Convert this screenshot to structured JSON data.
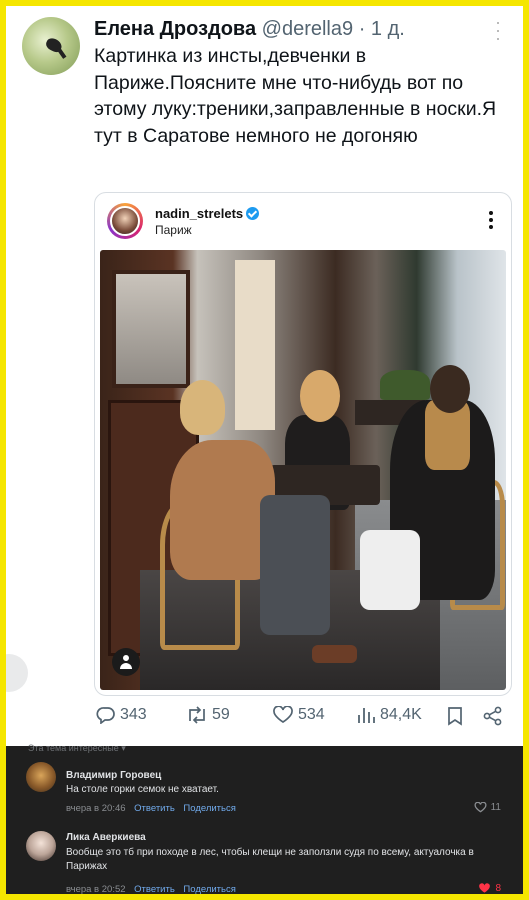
{
  "tweet": {
    "author_name": "Елена Дроздова",
    "handle": "@derella9",
    "separator": "·",
    "time": "1 д.",
    "text": "Картинка из инсты,девченки в Париже.Поясните мне что-нибудь вот по этому луку:треники,заправленные в носки.Я тут в Саратове немного не догоняю"
  },
  "embed": {
    "username": "nadin_strelets",
    "location": "Париж"
  },
  "actions": {
    "replies": "343",
    "reposts": "59",
    "likes": "534",
    "views": "84,4K"
  },
  "comments": {
    "header": "Эта тема интересные ▾",
    "items": [
      {
        "author": "Владимир Горовец",
        "text": "На столе горки семок не хватает.",
        "time": "вчера в 20:46",
        "reply": "Ответить",
        "share": "Поделиться",
        "likes": "11",
        "liked": false
      },
      {
        "author": "Лика Аверкиева",
        "text": "Вообще это тб при походе в лес, чтобы клещи не заползли судя по всему, актуалочка в Парижах",
        "time": "вчера в 20:52",
        "reply": "Ответить",
        "share": "Поделиться",
        "likes": "8",
        "liked": true
      }
    ]
  },
  "colors": {
    "frame": "#f5e600",
    "link": "#1d9bf0",
    "muted": "#536471",
    "comments_bg": "#1f1f1f",
    "like_red": "#ff3347"
  }
}
